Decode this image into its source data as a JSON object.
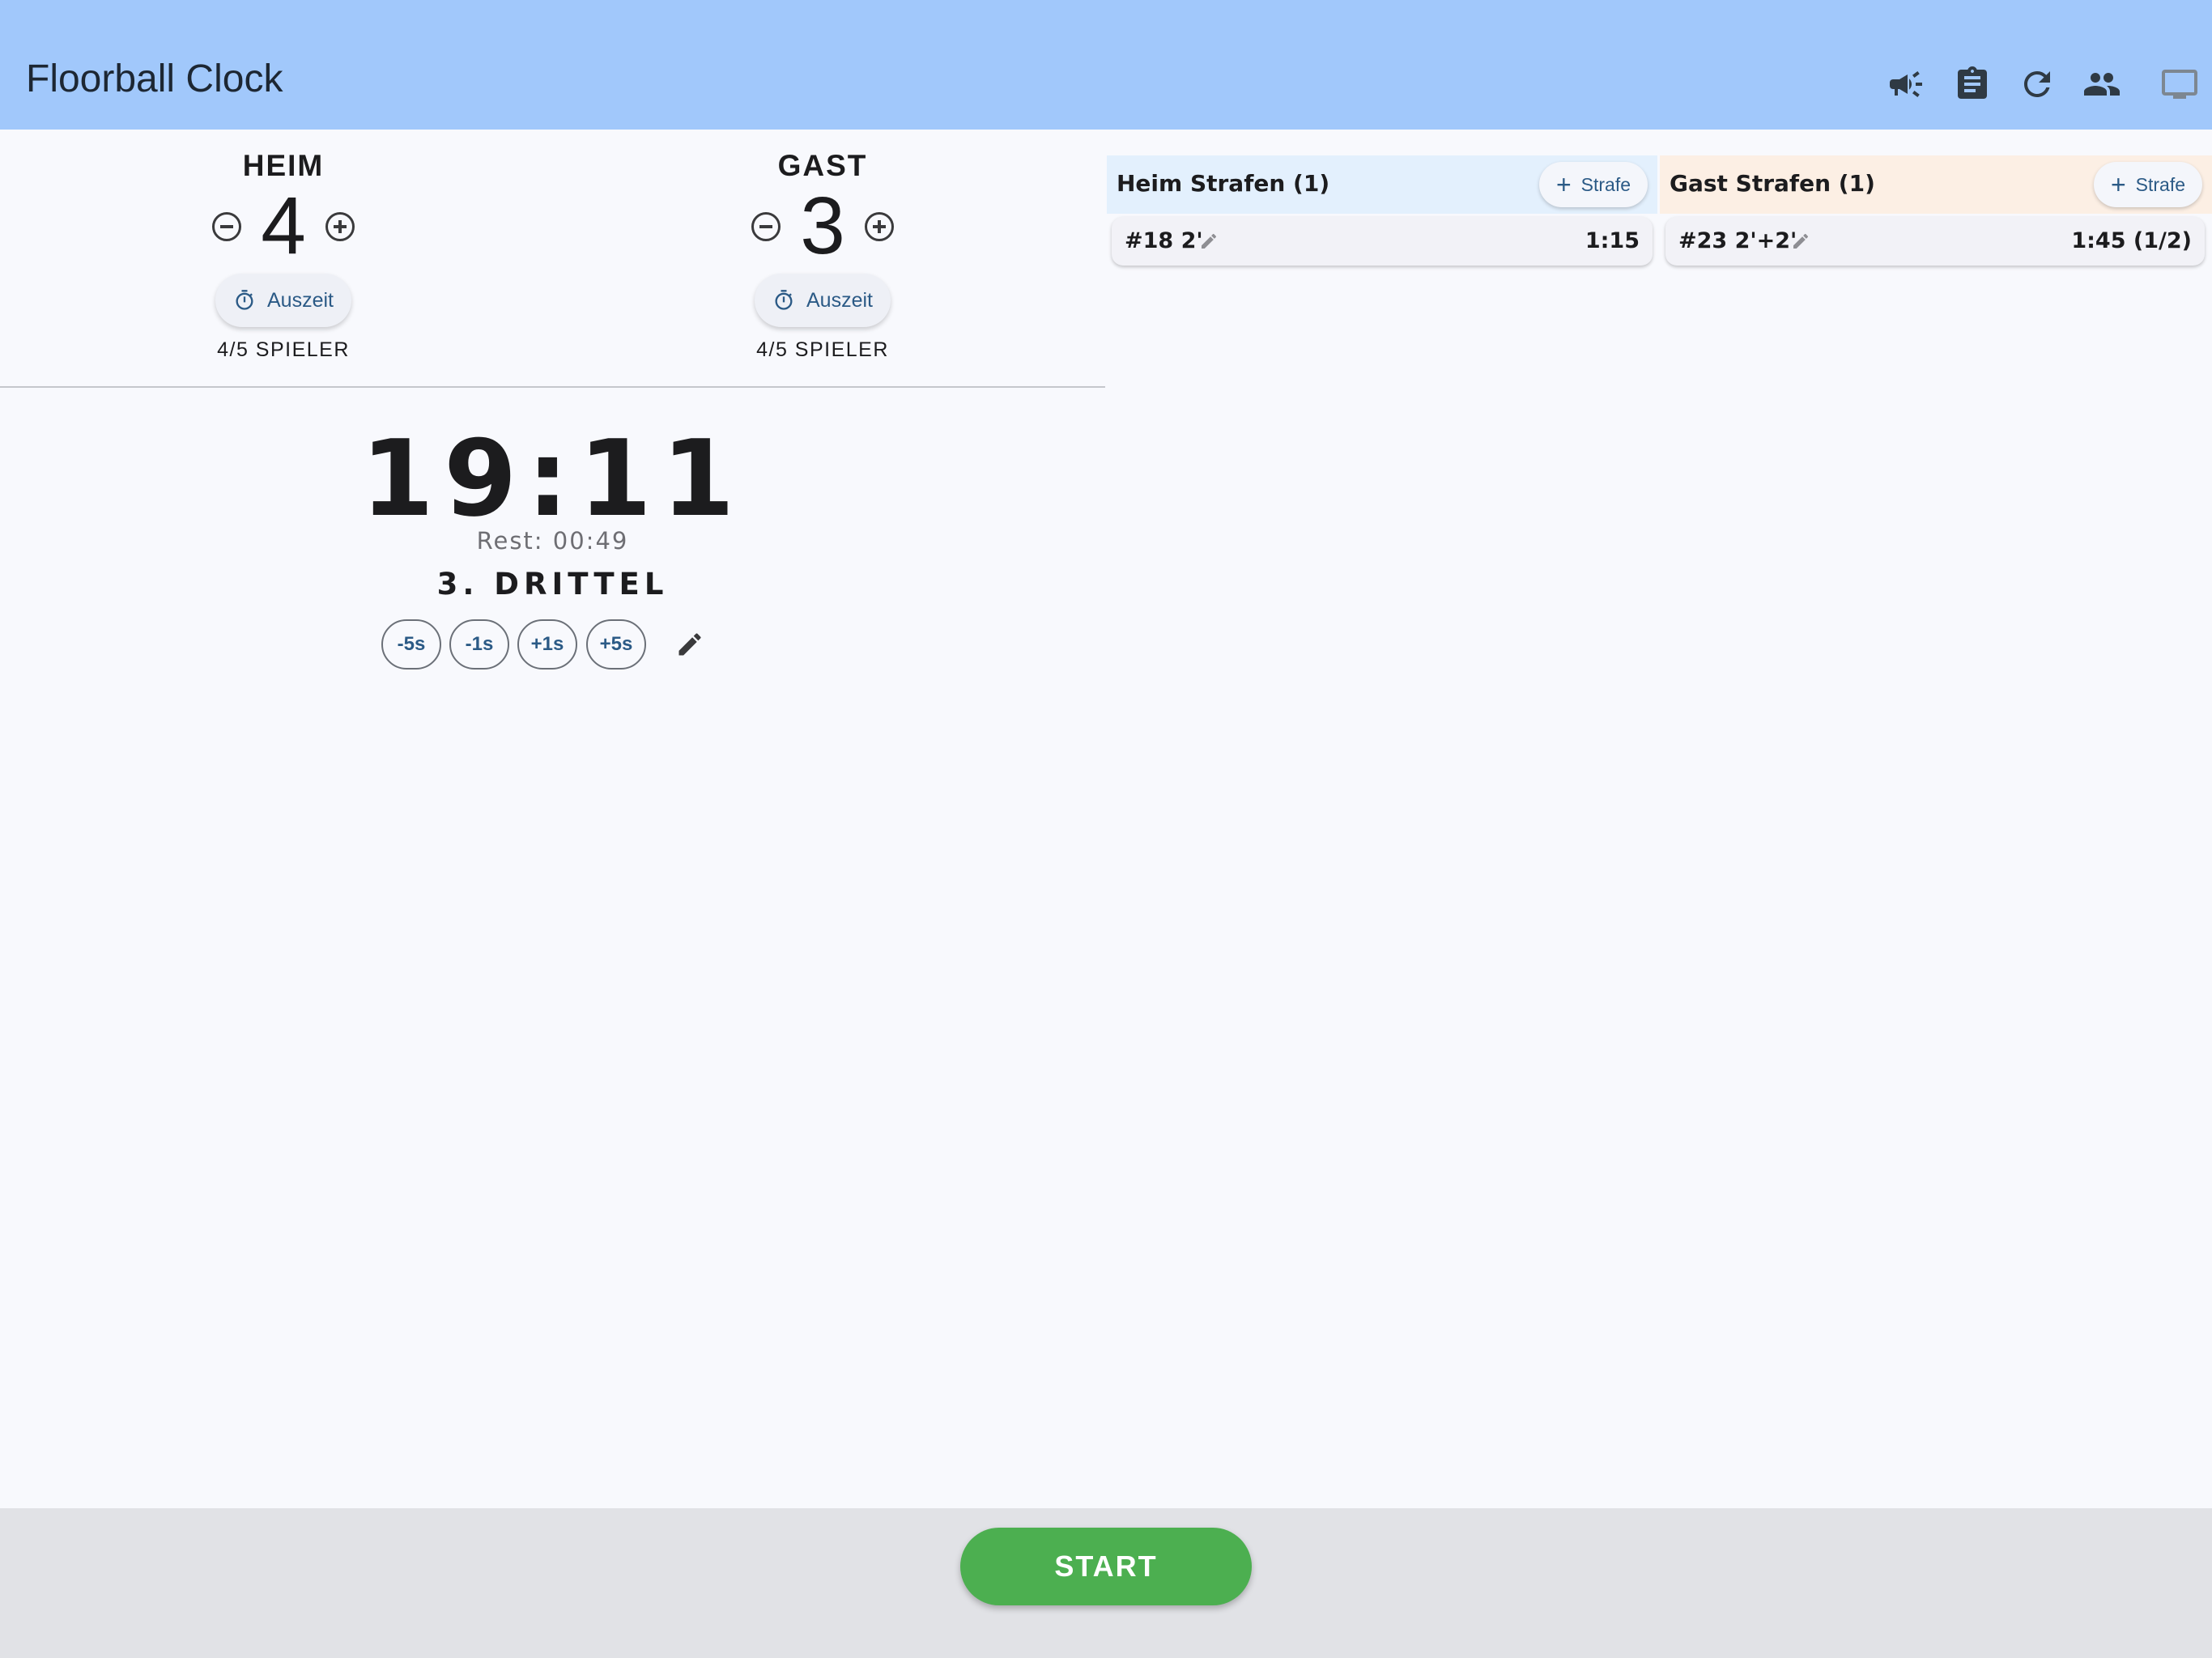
{
  "app": {
    "title": "Floorball Clock"
  },
  "toolbar": {
    "icons": [
      "megaphone-icon",
      "clipboard-icon",
      "refresh-icon",
      "people-icon",
      "monitor-icon"
    ]
  },
  "home": {
    "name": "HEIM",
    "score": "4",
    "timeout_label": "Auszeit",
    "players": "4/5 SPIELER"
  },
  "away": {
    "name": "GAST",
    "score": "3",
    "timeout_label": "Auszeit",
    "players": "4/5 SPIELER"
  },
  "clock": {
    "time": "19:11",
    "rest": "Rest: 00:49",
    "period": "3. DRITTEL",
    "adjust": [
      "-5s",
      "-1s",
      "+1s",
      "+5s"
    ]
  },
  "penalties": {
    "home": {
      "title": "Heim Strafen (1)",
      "add_label": "Strafe",
      "items": [
        {
          "player": "#18 2'",
          "time": "1:15"
        }
      ]
    },
    "away": {
      "title": "Gast Strafen (1)",
      "add_label": "Strafe",
      "items": [
        {
          "player": "#23 2'+2'",
          "time": "1:45 (1/2)"
        }
      ]
    }
  },
  "footer": {
    "start_label": "START"
  },
  "colors": {
    "appbar": "#a1c8fb",
    "home_panel": "#e3f0fd",
    "away_panel": "#fcefe4",
    "start": "#4caf50",
    "accent_text": "#2b5a86"
  }
}
